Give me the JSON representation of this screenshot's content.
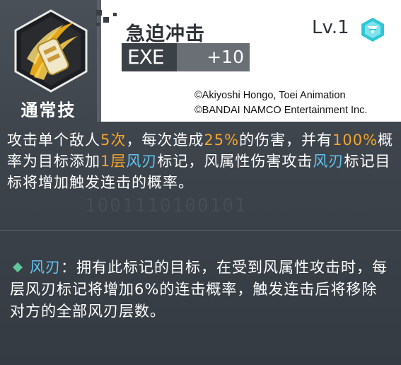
{
  "skill": {
    "type_label": "通常技",
    "name": "急迫冲击",
    "level": "Lv.1",
    "exe_label": "EXE",
    "exe_bonus": "+10",
    "icon": "golden-slash-skill-icon",
    "rank_icon": "cyan-diamond-badge-icon"
  },
  "copyright": {
    "line1": "©Akiyoshi Hongo, Toei Animation",
    "line2": "©BANDAI NAMCO Entertainment Inc."
  },
  "description": {
    "p1": "攻击单个敌人",
    "v_hits": "5次",
    "p2": "，每次造成",
    "v_damage": "25%",
    "p3": "的伤害，并有",
    "v_chance": "100%",
    "p4": "概率为目标添加",
    "v_layers": "1层",
    "k_mark1": "风刃",
    "p5": "标记，风属性伤害攻击",
    "k_mark2": "风刃",
    "p6": "标记目标将增加触发连击的概率。"
  },
  "note": {
    "keyword": "风刃",
    "text": "：拥有此标记的目标，在受到风属性攻击时，每层风刃标记将增加6%的连击概率，触发连击后将移除对方的全部风刃层数。"
  },
  "watermark": "1001110100101",
  "colors": {
    "highlight_orange": "#f4a52a",
    "highlight_blue": "#62c2f0",
    "bullet_green": "#5fc79a"
  }
}
